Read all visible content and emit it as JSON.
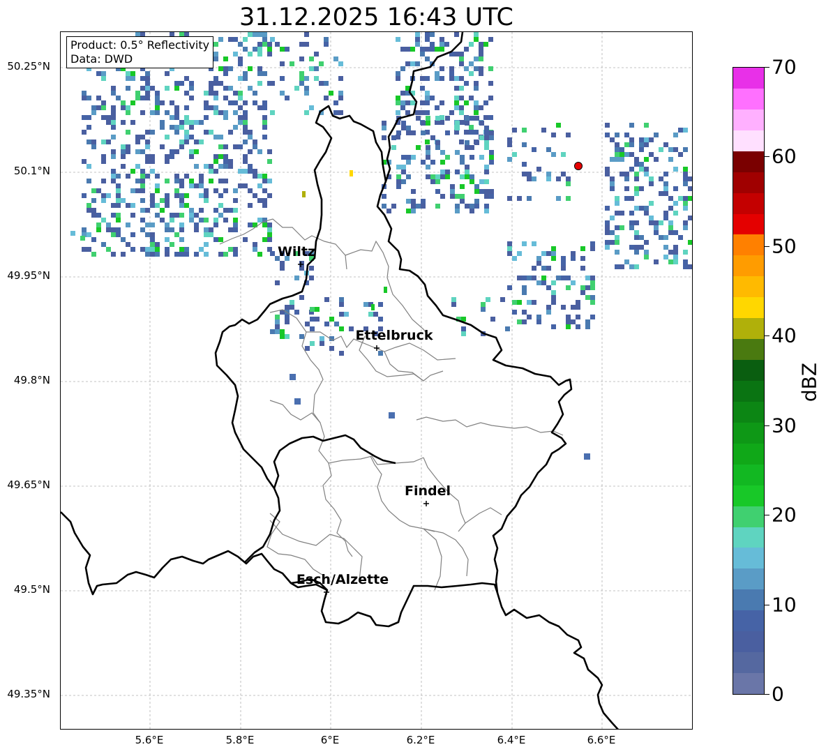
{
  "title": "31.12.2025 16:43 UTC",
  "info": {
    "product": "Product: 0.5° Reflectivity",
    "data": "Data: DWD"
  },
  "lat_ticks": [
    "50.25°N",
    "50.1°N",
    "49.95°N",
    "49.8°N",
    "49.65°N",
    "49.5°N",
    "49.35°N"
  ],
  "lon_ticks": [
    "5.6°E",
    "5.8°E",
    "6°E",
    "6.2°E",
    "6.4°E",
    "6.6°E"
  ],
  "cities": [
    {
      "name": "Wiltz"
    },
    {
      "name": "Ettelbruck"
    },
    {
      "name": "Findel"
    },
    {
      "name": "Esch/Alzette"
    }
  ],
  "colorbar": {
    "label": "dBZ",
    "ticks": [
      "0",
      "10",
      "20",
      "30",
      "40",
      "50",
      "60",
      "70"
    ],
    "colors": [
      "#6a76a8",
      "#5568a0",
      "#4a5fa0",
      "#4663a6",
      "#4a7ab0",
      "#5a9cc6",
      "#66bcd8",
      "#5fd4c0",
      "#40d070",
      "#18c828",
      "#12b822",
      "#10a818",
      "#0e9816",
      "#0c8614",
      "#0a7412",
      "#0a5e10",
      "#4a7a10",
      "#b0b00a",
      "#ffd700",
      "#ffba00",
      "#ff9c00",
      "#ff8000",
      "#e40000",
      "#c40000",
      "#a00000",
      "#7a0000",
      "#ffe0ff",
      "#ffb0ff",
      "#ff70ff",
      "#e830e8"
    ]
  },
  "markers": {
    "radar_site_color": "#e60000"
  }
}
